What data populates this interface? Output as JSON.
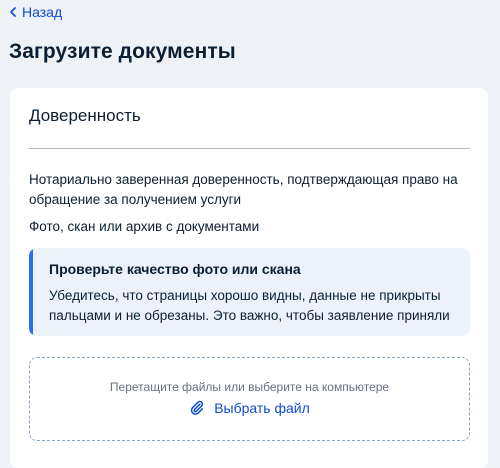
{
  "nav": {
    "back_label": "Назад"
  },
  "page": {
    "title": "Загрузите документы"
  },
  "document": {
    "title": "Доверенность",
    "description": "Нотариально заверенная доверенность, подтверждающая право на обращение за получением услуги",
    "formats": "Фото, скан или архив с документами"
  },
  "notice": {
    "title": "Проверьте качество фото или скана",
    "text": "Убедитесь, что страницы хорошо видны, данные не прикрыты пальцами и не обрезаны. Это важно, чтобы заявление приняли"
  },
  "upload": {
    "hint": "Перетащите файлы или выберите на компьютере",
    "button_label": "Выбрать файл",
    "icon": "paperclip-icon"
  },
  "colors": {
    "accent": "#0d4cd3",
    "notice_bar": "#2a6ef0",
    "notice_bg": "#ecf1fb",
    "page_bg": "#eef2f7"
  }
}
